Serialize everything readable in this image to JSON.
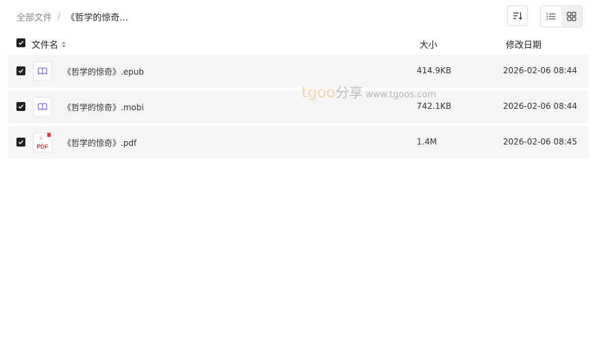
{
  "breadcrumb": {
    "root": "全部文件",
    "separator": "/",
    "current": "《哲学的惊奇..."
  },
  "toolbar": {
    "sort_icon": "sort-icon",
    "list_view_icon": "list-view-icon",
    "grid_view_icon": "grid-view-icon"
  },
  "table": {
    "columns": {
      "name": "文件名",
      "size": "大小",
      "date": "修改日期"
    },
    "rows": [
      {
        "name": "《哲学的惊奇》.epub",
        "size": "414.9KB",
        "date": "2026-02-06 08:44",
        "icon": "ebook-icon",
        "checked": true
      },
      {
        "name": "《哲学的惊奇》.mobi",
        "size": "742.1KB",
        "date": "2026-02-06 08:44",
        "icon": "ebook-icon",
        "checked": true
      },
      {
        "name": "《哲学的惊奇》.pdf",
        "size": "1.4M",
        "date": "2026-02-06 08:45",
        "icon": "pdf-icon",
        "pdf_label": "PDF",
        "checked": true
      }
    ]
  },
  "watermark": {
    "brand": "tgoo",
    "share": "分享",
    "url": "www.tgoos.com"
  },
  "colors": {
    "row_bg": "#f5f5f5",
    "checkbox": "#1f1f1f",
    "ebook_icon": "#7b6fd6",
    "pdf_icon": "#e0393e"
  }
}
